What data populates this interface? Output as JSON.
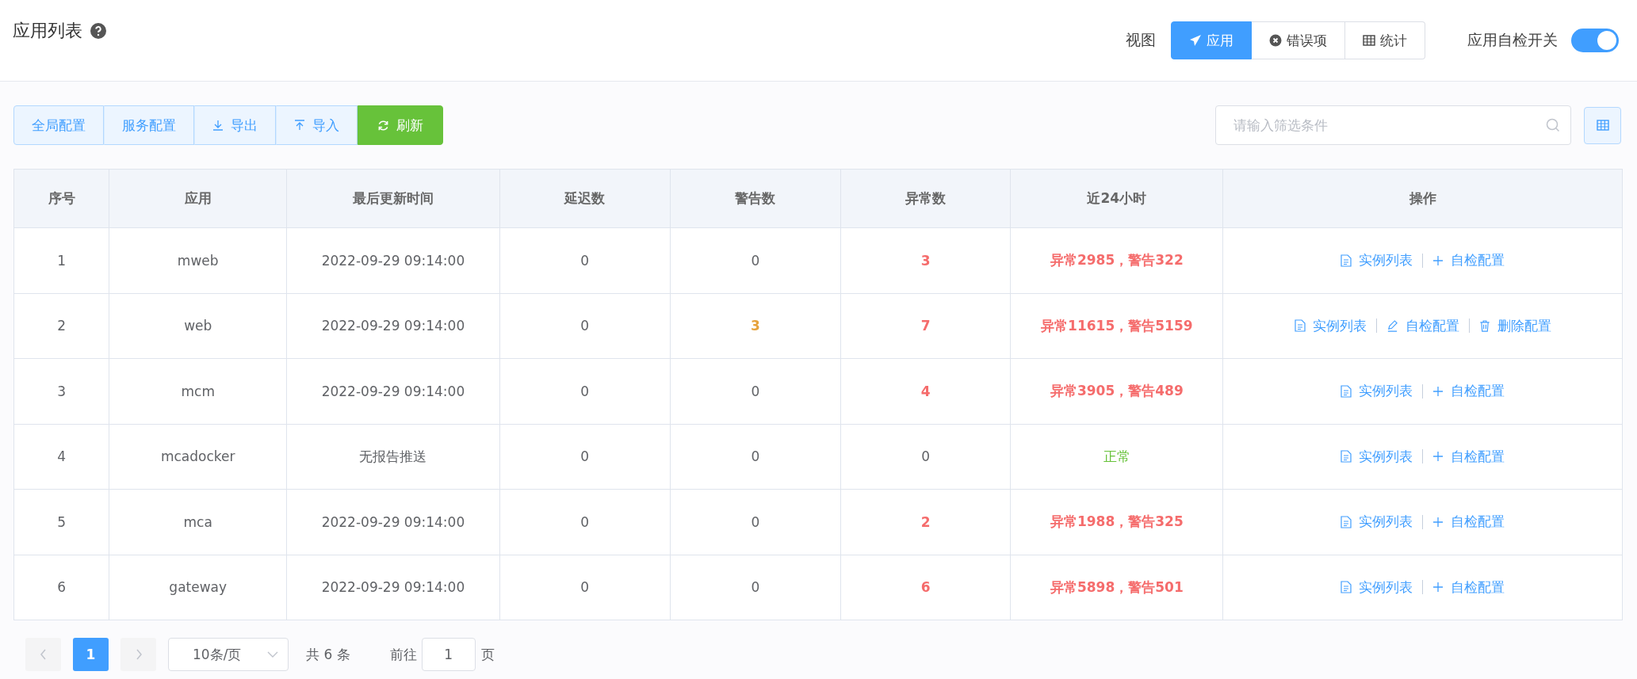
{
  "header": {
    "title": "应用列表",
    "view_label": "视图",
    "views": [
      {
        "label": "应用",
        "kind": "send",
        "selected": true
      },
      {
        "label": "错误项",
        "kind": "error",
        "selected": false
      },
      {
        "label": "统计",
        "kind": "stats",
        "selected": false
      }
    ],
    "switch": {
      "label": "应用自检开关",
      "on": true
    }
  },
  "toolbar": {
    "buttons": [
      {
        "label": "全局配置",
        "kind": "plain"
      },
      {
        "label": "服务配置",
        "kind": "plain"
      },
      {
        "label": "导出",
        "kind": "download"
      },
      {
        "label": "导入",
        "kind": "upload"
      },
      {
        "label": "刷新",
        "kind": "refresh"
      }
    ],
    "search": {
      "placeholder": "请输入筛选条件"
    }
  },
  "table": {
    "columns": [
      "序号",
      "应用",
      "最后更新时间",
      "延迟数",
      "警告数",
      "异常数",
      "近24小时",
      "操作"
    ],
    "rows": [
      {
        "cells": [
          {
            "text": "1",
            "kind": "normal"
          },
          {
            "text": "mweb",
            "kind": "normal"
          },
          {
            "text": "2022-09-29 09:14:00",
            "kind": "normal"
          },
          {
            "text": "0",
            "kind": "normal"
          },
          {
            "text": "0",
            "kind": "normal"
          },
          {
            "text": "3",
            "kind": "danger"
          },
          {
            "text": "异常2985，警告322",
            "kind": "danger"
          }
        ],
        "actions": [
          {
            "label": "实例列表",
            "kind": "list"
          },
          {
            "label": "自检配置",
            "kind": "add"
          }
        ]
      },
      {
        "cells": [
          {
            "text": "2",
            "kind": "normal"
          },
          {
            "text": "web",
            "kind": "normal"
          },
          {
            "text": "2022-09-29 09:14:00",
            "kind": "normal"
          },
          {
            "text": "0",
            "kind": "normal"
          },
          {
            "text": "3",
            "kind": "warning"
          },
          {
            "text": "7",
            "kind": "danger"
          },
          {
            "text": "异常11615，警告5159",
            "kind": "danger"
          }
        ],
        "actions": [
          {
            "label": "实例列表",
            "kind": "list"
          },
          {
            "label": "自检配置",
            "kind": "edit"
          },
          {
            "label": "删除配置",
            "kind": "delete"
          }
        ]
      },
      {
        "cells": [
          {
            "text": "3",
            "kind": "normal"
          },
          {
            "text": "mcm",
            "kind": "normal"
          },
          {
            "text": "2022-09-29 09:14:00",
            "kind": "normal"
          },
          {
            "text": "0",
            "kind": "normal"
          },
          {
            "text": "0",
            "kind": "normal"
          },
          {
            "text": "4",
            "kind": "danger"
          },
          {
            "text": "异常3905，警告489",
            "kind": "danger"
          }
        ],
        "actions": [
          {
            "label": "实例列表",
            "kind": "list"
          },
          {
            "label": "自检配置",
            "kind": "add"
          }
        ]
      },
      {
        "cells": [
          {
            "text": "4",
            "kind": "normal"
          },
          {
            "text": "mcadocker",
            "kind": "normal"
          },
          {
            "text": "无报告推送",
            "kind": "normal"
          },
          {
            "text": "0",
            "kind": "normal"
          },
          {
            "text": "0",
            "kind": "normal"
          },
          {
            "text": "0",
            "kind": "normal"
          },
          {
            "text": "正常",
            "kind": "success"
          }
        ],
        "actions": [
          {
            "label": "实例列表",
            "kind": "list"
          },
          {
            "label": "自检配置",
            "kind": "add"
          }
        ]
      },
      {
        "cells": [
          {
            "text": "5",
            "kind": "normal"
          },
          {
            "text": "mca",
            "kind": "normal"
          },
          {
            "text": "2022-09-29 09:14:00",
            "kind": "normal"
          },
          {
            "text": "0",
            "kind": "normal"
          },
          {
            "text": "0",
            "kind": "normal"
          },
          {
            "text": "2",
            "kind": "danger"
          },
          {
            "text": "异常1988，警告325",
            "kind": "danger"
          }
        ],
        "actions": [
          {
            "label": "实例列表",
            "kind": "list"
          },
          {
            "label": "自检配置",
            "kind": "add"
          }
        ]
      },
      {
        "cells": [
          {
            "text": "6",
            "kind": "normal"
          },
          {
            "text": "gateway",
            "kind": "normal"
          },
          {
            "text": "2022-09-29 09:14:00",
            "kind": "normal"
          },
          {
            "text": "0",
            "kind": "normal"
          },
          {
            "text": "0",
            "kind": "normal"
          },
          {
            "text": "6",
            "kind": "danger"
          },
          {
            "text": "异常5898，警告501",
            "kind": "danger"
          }
        ],
        "actions": [
          {
            "label": "实例列表",
            "kind": "list"
          },
          {
            "label": "自检配置",
            "kind": "add"
          }
        ]
      }
    ]
  },
  "pagination": {
    "prev_disabled": true,
    "next_disabled": true,
    "pages": [
      {
        "label": "1",
        "selected": true
      }
    ],
    "page_size": "10条/页",
    "total": "共 6 条",
    "goto_label": "前往",
    "goto_value": "1",
    "page_unit": "页"
  }
}
